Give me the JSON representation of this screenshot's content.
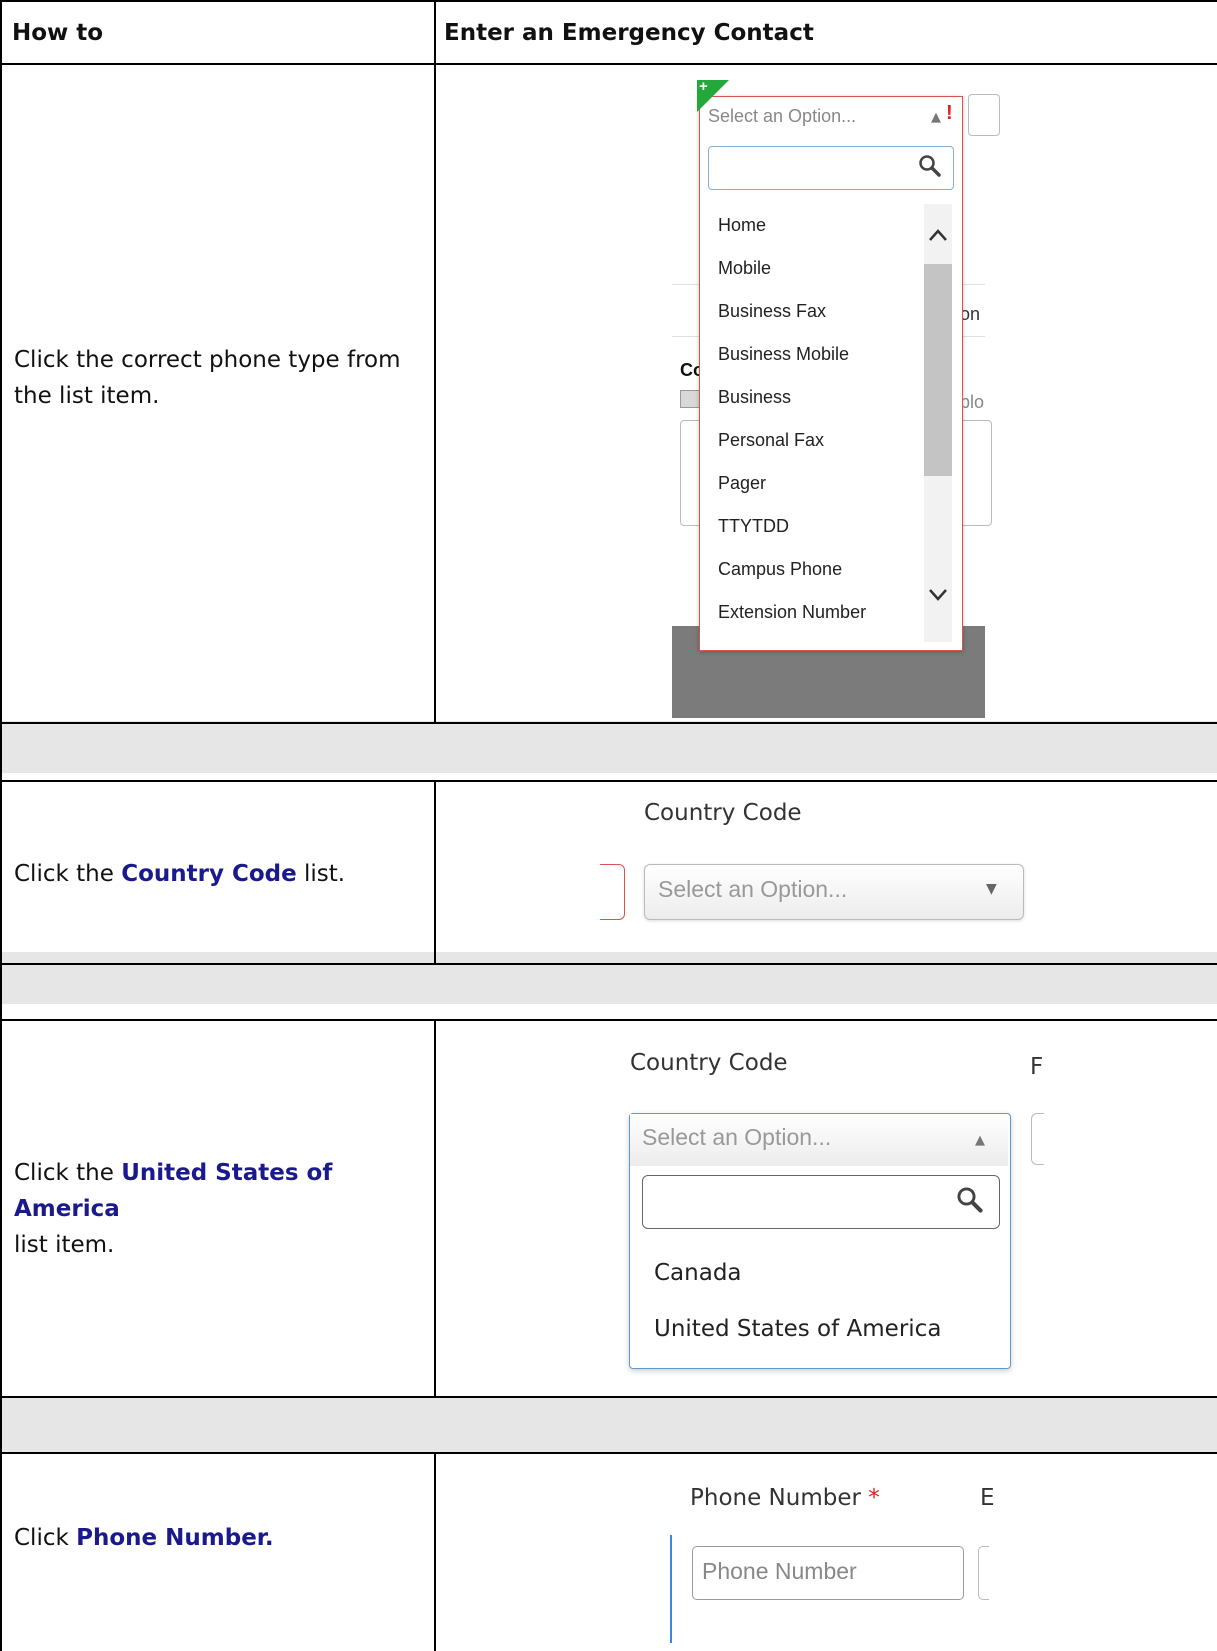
{
  "header": {
    "col1": "How to",
    "col2": "Enter an Emergency Contact"
  },
  "steps": [
    {
      "instruction": "Click the correct phone type from the list item.",
      "screenshot": {
        "dropdown_placeholder": "Select an Option...",
        "options": [
          "Home",
          "Mobile",
          "Business Fax",
          "Business Mobile",
          "Business",
          "Personal Fax",
          "Pager",
          "TTYTDD",
          "Campus Phone",
          "Extension Number"
        ],
        "partial_heading": "Co",
        "partial_text_1": "on",
        "partial_text_2": "plo"
      }
    },
    {
      "instruction_prefix": "Click the ",
      "instruction_bold": "Country Code",
      "instruction_suffix": " list.",
      "screenshot": {
        "field_label": "Country Code",
        "dropdown_placeholder": "Select an Option..."
      }
    },
    {
      "instruction_prefix": "Click the ",
      "instruction_bold": "United States of America",
      "instruction_suffix": "list item.",
      "screenshot": {
        "field_label": "Country Code",
        "partial_label": "F",
        "dropdown_placeholder": "Select an Option...",
        "options": [
          "Canada",
          "United States of America"
        ]
      }
    },
    {
      "instruction_prefix": "Click ",
      "instruction_bold": "Phone Number.",
      "screenshot": {
        "field_label": "Phone Number",
        "required_marker": "*",
        "partial_label": "E",
        "input_placeholder": "Phone Number"
      }
    }
  ]
}
